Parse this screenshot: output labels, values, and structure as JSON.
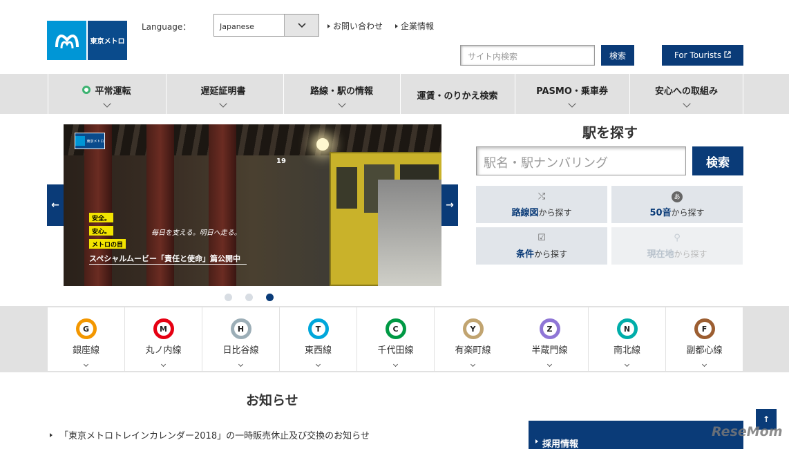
{
  "header": {
    "logo_text": "東京メトロ",
    "language_label": "Language：",
    "language_value": "Japanese",
    "links": [
      "お問い合わせ",
      "企業情報"
    ],
    "search_placeholder": "サイト内検索",
    "search_button": "検索",
    "tourists_button": "For Tourists"
  },
  "gnav": [
    {
      "label": "平常運転"
    },
    {
      "label": "遅延証明書"
    },
    {
      "label": "路線・駅の情報"
    },
    {
      "label": "運賃・のりかえ検索"
    },
    {
      "label": "PASMO・乗車券"
    },
    {
      "label": "安心への取組み"
    }
  ],
  "hero": {
    "mini_logo": "東京メトロ",
    "tags": [
      "安全。",
      "安心。",
      "メトロの目"
    ],
    "slogan": "毎日を支える。明日へ走る。",
    "movie": "スペシャルムービー「責任と使命」篇公開中",
    "train_number": "19",
    "active_slide": 3
  },
  "station_search": {
    "title": "駅を探す",
    "placeholder": "駅名・駅ナンバリング",
    "button": "検索",
    "options": [
      {
        "bold": "路線図",
        "rest": "から探す",
        "icon": "route-icon",
        "glyph": "⤭",
        "disabled": false
      },
      {
        "bold": "50音",
        "rest": "から探す",
        "icon": "kana-icon",
        "glyph": "あ",
        "disabled": false
      },
      {
        "bold": "条件",
        "rest": "から探す",
        "icon": "checkbox-icon",
        "glyph": "☑",
        "disabled": false
      },
      {
        "bold": "現在地",
        "rest": "から探す",
        "icon": "location-pin-icon",
        "glyph": "⚲",
        "disabled": true
      }
    ]
  },
  "lines": [
    {
      "letter": "G",
      "name": "銀座線",
      "color": "#f39700"
    },
    {
      "letter": "M",
      "name": "丸ノ内線",
      "color": "#e60012"
    },
    {
      "letter": "H",
      "name": "日比谷線",
      "color": "#9caeb7"
    },
    {
      "letter": "T",
      "name": "東西線",
      "color": "#00a7db"
    },
    {
      "letter": "C",
      "name": "千代田線",
      "color": "#009944"
    },
    {
      "letter": "Y",
      "name": "有楽町線",
      "color": "#c1a470"
    },
    {
      "letter": "Z",
      "name": "半蔵門線",
      "color": "#8f76d6"
    },
    {
      "letter": "N",
      "name": "南北線",
      "color": "#00ada9"
    },
    {
      "letter": "F",
      "name": "副都心線",
      "color": "#9c5e31"
    }
  ],
  "news": {
    "title": "お知らせ",
    "items": [
      "「東京メトロトレインカレンダー2018」の一時販売休止及び交換のお知らせ"
    ]
  },
  "recruit_label": "採用情報",
  "watermark": "ReseMom"
}
